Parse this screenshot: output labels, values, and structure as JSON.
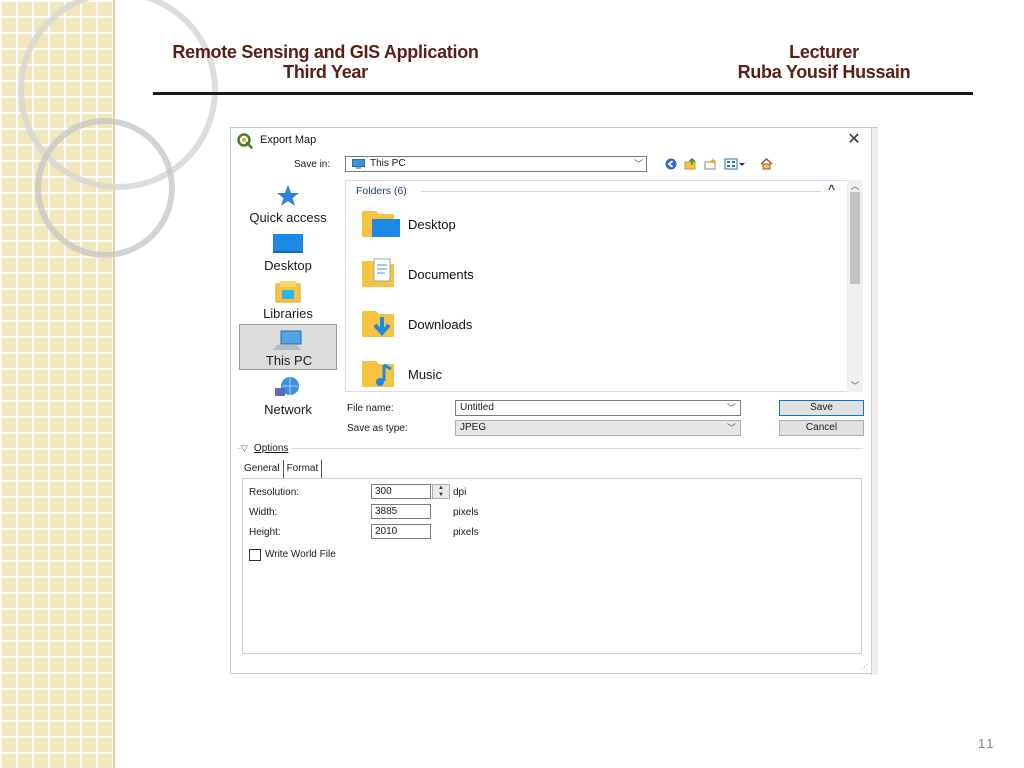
{
  "slide": {
    "header_left_line1": "Remote Sensing and GIS Application",
    "header_left_line2": "Third Year",
    "header_right_line1": "Lecturer",
    "header_right_line2": "Ruba Yousif Hussain",
    "page_number": "11"
  },
  "dialog": {
    "title": "Export Map",
    "close_glyph": "✕",
    "save_in_label": "Save in:",
    "save_in_value": "This PC",
    "places": [
      {
        "label": "Quick access",
        "icon": "star-icon"
      },
      {
        "label": "Desktop",
        "icon": "desktop-icon"
      },
      {
        "label": "Libraries",
        "icon": "libraries-icon"
      },
      {
        "label": "This PC",
        "icon": "computer-icon",
        "selected": true
      },
      {
        "label": "Network",
        "icon": "network-icon"
      }
    ],
    "folders_header": "Folders (6)",
    "folders": [
      {
        "label": "Desktop",
        "icon": "desktop-folder-icon"
      },
      {
        "label": "Documents",
        "icon": "documents-folder-icon"
      },
      {
        "label": "Downloads",
        "icon": "downloads-folder-icon"
      },
      {
        "label": "Music",
        "icon": "music-folder-icon"
      }
    ],
    "file_name_label": "File name:",
    "file_name_value": "Untitled",
    "save_as_type_label": "Save as type:",
    "save_as_type_value": "JPEG",
    "save_button": "Save",
    "cancel_button": "Cancel",
    "options_label": "Options",
    "tabs": [
      "General",
      "Format"
    ],
    "resolution_label": "Resolution:",
    "resolution_value": "300",
    "resolution_unit": "dpi",
    "width_label": "Width:",
    "width_value": "3885",
    "width_unit": "pixels",
    "height_label": "Height:",
    "height_value": "2010",
    "height_unit": "pixels",
    "world_file_label": "Write World File",
    "world_file_checked": false
  },
  "colors": {
    "header_text": "#5a1f14",
    "folder_header": "#1e3f80",
    "default_button_border": "#0078d7"
  }
}
